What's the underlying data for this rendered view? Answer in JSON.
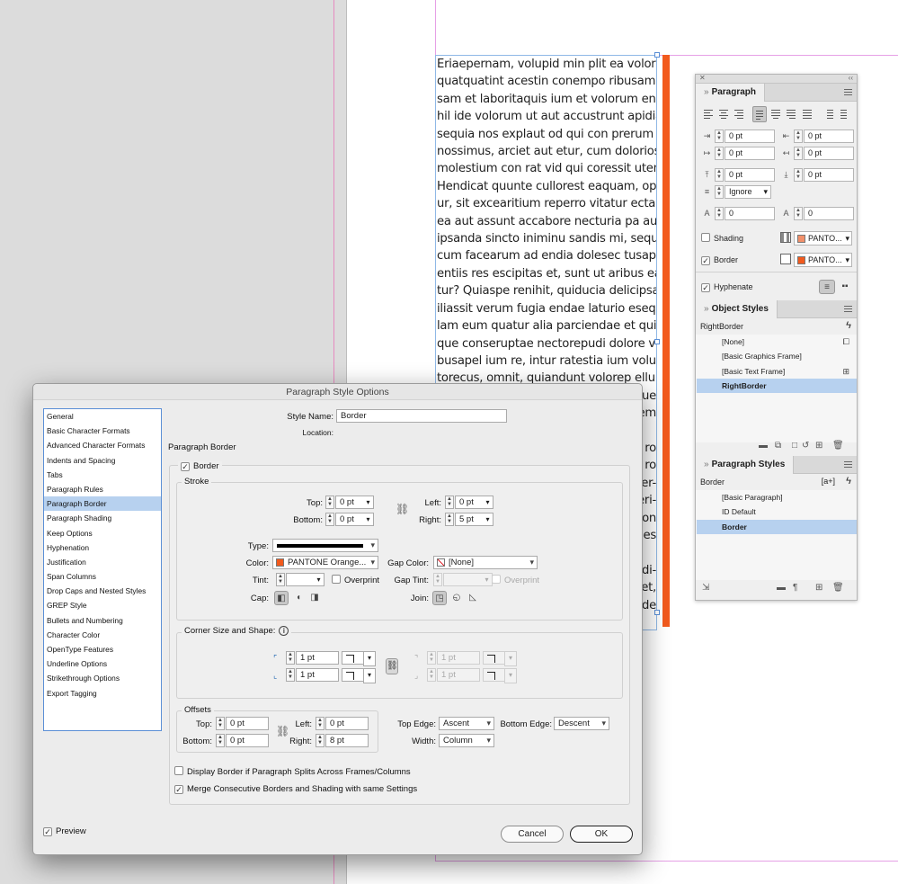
{
  "document": {
    "body_lines": [
      "Eriaepernam, volupid min plit ea volorem",
      "quatquatint acestin conempo ribusam",
      "sam et laboritaquis ium et volorum eni-",
      "hil ide volorum ut aut accustrunt apidia",
      "sequia nos explaut od qui con prerum sa",
      "nossimus, arciet aut etur, cum dolorios",
      "molestium con rat vid qui coressit utent.",
      "Hendicat quunte cullorest eaquam, optat-",
      "ur, sit excearitium reperro vitatur ectame",
      "ea aut assunt accabore necturia pa aut et",
      "ipsanda sincto iniminu sandis mi, sequam",
      "cum facearum ad endia dolesec tusapid",
      "entiis res escipitas et, sunt ut aribus ea-",
      "tur? Quiaspe renihit, quiducia delicipsa",
      "iliassit verum fugia endae laturio eseque",
      "lam eum quatur alia parciendae et qui id",
      "que conseruptae nectorepudi dolore veli-",
      "busapel ium re, intur ratestia ium volupic",
      "torecus, omnit, quiandunt volorep ellup-",
      "ue",
      "em",
      "",
      "ro",
      "ro",
      "er-",
      "eri-",
      "on",
      "es",
      "",
      "di-",
      "et,",
      "de"
    ],
    "border_color": "#F25A1D"
  },
  "paragraph_panel": {
    "tab": "Paragraph",
    "left_indent": "0 pt",
    "right_indent": "0 pt",
    "first_line_indent": "0 pt",
    "last_line_right_indent": "0 pt",
    "space_before": "0 pt",
    "space_after": "0 pt",
    "align_to_grid": "Ignore",
    "drop_cap_lines": "0",
    "drop_cap_chars": "0",
    "shading_label": "Shading",
    "shading_color": "PANTO...",
    "shading_swatch": "#F2906A",
    "border_label": "Border",
    "border_color": "PANTO...",
    "border_swatch": "#F25A1D",
    "hyphenate_label": "Hyphenate"
  },
  "object_styles_panel": {
    "tab": "Object Styles",
    "current": "RightBorder",
    "items": [
      "[None]",
      "[Basic Graphics Frame]",
      "[Basic Text Frame]",
      "RightBorder"
    ]
  },
  "paragraph_styles_panel": {
    "tab": "Paragraph Styles",
    "current": "Border",
    "current_badge": "[a+]",
    "items": [
      "[Basic Paragraph]",
      "ID Default",
      "Border"
    ]
  },
  "dialog": {
    "title": "Paragraph Style Options",
    "categories": [
      "General",
      "Basic Character Formats",
      "Advanced Character Formats",
      "Indents and Spacing",
      "Tabs",
      "Paragraph Rules",
      "Paragraph Border",
      "Paragraph Shading",
      "Keep Options",
      "Hyphenation",
      "Justification",
      "Span Columns",
      "Drop Caps and Nested Styles",
      "GREP Style",
      "Bullets and Numbering",
      "Character Color",
      "OpenType Features",
      "Underline Options",
      "Strikethrough Options",
      "Export Tagging"
    ],
    "selected_category": "Paragraph Border",
    "style_name_label": "Style Name:",
    "style_name": "Border",
    "location_label": "Location:",
    "section_title": "Paragraph Border",
    "border_checkbox": "Border",
    "stroke": {
      "title": "Stroke",
      "top_label": "Top:",
      "top": "0 pt",
      "bottom_label": "Bottom:",
      "bottom": "0 pt",
      "left_label": "Left:",
      "left": "0 pt",
      "right_label": "Right:",
      "right": "5 pt",
      "type_label": "Type:",
      "color_label": "Color:",
      "color": "PANTONE Orange...",
      "color_swatch": "#F25A1D",
      "gap_color_label": "Gap Color:",
      "gap_color": "[None]",
      "tint_label": "Tint:",
      "tint": "",
      "overprint_label": "Overprint",
      "gap_tint_label": "Gap Tint:",
      "gap_tint": "",
      "gap_overprint_label": "Overprint",
      "cap_label": "Cap:",
      "join_label": "Join:"
    },
    "corners": {
      "title": "Corner Size and Shape:",
      "top_left": "1 pt",
      "bottom_left": "1 pt",
      "top_right": "1 pt",
      "bottom_right": "1 pt"
    },
    "offsets": {
      "title": "Offsets",
      "top_label": "Top:",
      "top": "0 pt",
      "bottom_label": "Bottom:",
      "bottom": "0 pt",
      "left_label": "Left:",
      "left": "0 pt",
      "right_label": "Right:",
      "right": "8 pt",
      "top_edge_label": "Top Edge:",
      "top_edge": "Ascent",
      "bottom_edge_label": "Bottom Edge:",
      "bottom_edge": "Descent",
      "width_label": "Width:",
      "width": "Column"
    },
    "display_split_label": "Display Border if Paragraph Splits Across Frames/Columns",
    "merge_label": "Merge Consecutive Borders and Shading with same Settings",
    "preview_label": "Preview",
    "cancel_label": "Cancel",
    "ok_label": "OK"
  }
}
